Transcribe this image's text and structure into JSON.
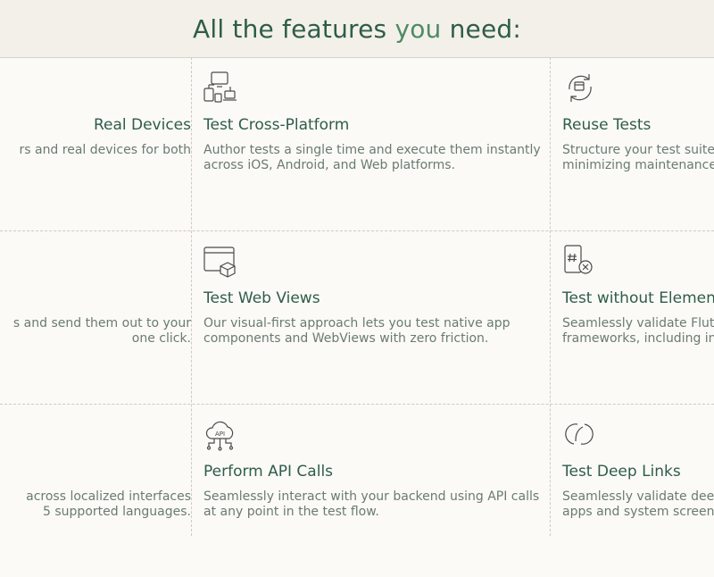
{
  "header": {
    "title_prefix": "All the features ",
    "title_accent": "you",
    "title_suffix": " need:"
  },
  "colors": {
    "primary": "#2f5d49",
    "accent": "#4e8a64",
    "text_muted": "#6a7b71",
    "background": "#fbfaf7",
    "header_bg": "#f3f0ea"
  },
  "features": {
    "real_devices": {
      "title": "Real Devices",
      "desc_line1": "rs and real devices for both",
      "desc_line2": ""
    },
    "cross_platform": {
      "icon": "devices-icon",
      "title": "Test Cross-Platform",
      "desc_line1": "Author tests a single time and execute them instantly",
      "desc_line2": "across iOS, Android, and Web platforms."
    },
    "reuse_tests": {
      "icon": "refresh-box-icon",
      "title": "Reuse Tests",
      "desc_line1": "Structure your test suite",
      "desc_line2": "minimizing maintenance a"
    },
    "share_results": {
      "title": "",
      "desc_line1": "s and send them out to your",
      "desc_line2": "one click."
    },
    "web_views": {
      "icon": "browser-box-icon",
      "title": "Test Web Views",
      "desc_line1": "Our visual-first approach lets you test native app",
      "desc_line2": "components and WebViews with zero friction."
    },
    "without_element_ids": {
      "icon": "hash-x-icon",
      "title": "Test without Element I",
      "desc_line1": "Seamlessly validate Flutt",
      "desc_line2": "frameworks, including int"
    },
    "localization": {
      "title": "",
      "desc_line1": "across localized interfaces",
      "desc_line2": "5 supported languages."
    },
    "api_calls": {
      "icon": "cloud-api-icon",
      "title": "Perform API Calls",
      "desc_line1": "Seamlessly interact with your backend using API calls",
      "desc_line2": "at any point in the test flow."
    },
    "deep_links": {
      "icon": "link-icon",
      "title": "Test Deep Links",
      "desc_line1": "Seamlessly validate deep",
      "desc_line2": "apps and system screens"
    }
  }
}
